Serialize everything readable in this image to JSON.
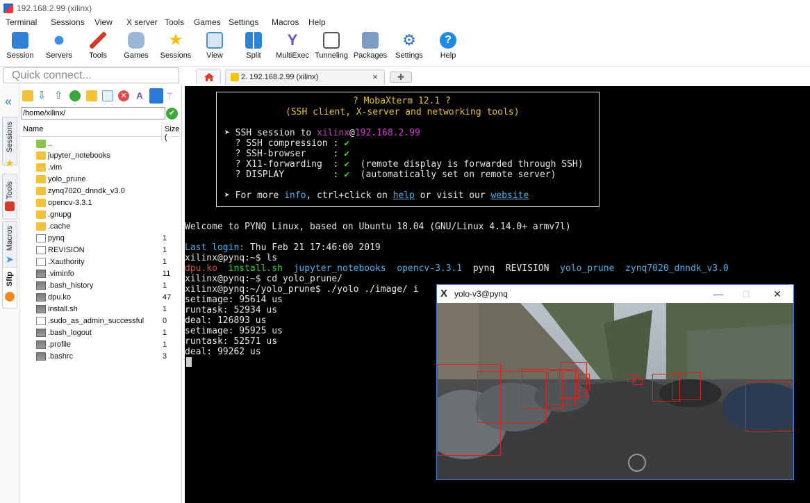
{
  "window": {
    "title": "192.168.2.99 (xilinx)"
  },
  "menu": [
    "Terminal",
    "Sessions",
    "View",
    "X server",
    "Tools",
    "Games",
    "Settings",
    "Macros",
    "Help"
  ],
  "toolbar": [
    {
      "label": "Session",
      "icon": "session-icon",
      "color": "#2f7fd6"
    },
    {
      "label": "Servers",
      "icon": "servers-icon",
      "color": "#3a8ee6"
    },
    {
      "label": "Tools",
      "icon": "tools-icon",
      "color": "#d23a2a"
    },
    {
      "label": "Games",
      "icon": "games-icon",
      "color": "#5aa0d8"
    },
    {
      "label": "Sessions",
      "icon": "star-icon",
      "color": "#f2c019"
    },
    {
      "label": "View",
      "icon": "view-icon",
      "color": "#4a8fcf"
    },
    {
      "label": "Split",
      "icon": "split-icon",
      "color": "#2c84d4"
    },
    {
      "label": "MultiExec",
      "icon": "multiexec-icon",
      "color": "#6a55c6"
    },
    {
      "label": "Tunneling",
      "icon": "tunneling-icon",
      "color": "#3aa83a"
    },
    {
      "label": "Packages",
      "icon": "packages-icon",
      "color": "#5a7fb0"
    },
    {
      "label": "Settings",
      "icon": "settings-icon",
      "color": "#2f6fc9"
    },
    {
      "label": "Help",
      "icon": "help-icon",
      "color": "#1e88e5"
    }
  ],
  "quick_connect": {
    "placeholder": "Quick connect..."
  },
  "tabs": [
    {
      "label": "2. 192.168.2.99 (xilinx)",
      "close": "×"
    }
  ],
  "side_tabs": [
    "Sessions",
    "Tools",
    "Macros",
    "Sftp"
  ],
  "sftp": {
    "path": "/home/xilinx/",
    "columns": {
      "name": "Name",
      "size": "Size ("
    },
    "files": [
      {
        "name": "..",
        "size": "",
        "type": "up"
      },
      {
        "name": "jupyter_notebooks",
        "size": "",
        "type": "folder"
      },
      {
        "name": ".vim",
        "size": "",
        "type": "folder"
      },
      {
        "name": "yolo_prune",
        "size": "",
        "type": "folder"
      },
      {
        "name": "zynq7020_dnndk_v3.0",
        "size": "",
        "type": "folder"
      },
      {
        "name": "opencv-3.3.1",
        "size": "",
        "type": "folder"
      },
      {
        "name": ".gnupg",
        "size": "",
        "type": "folder"
      },
      {
        "name": ".cache",
        "size": "",
        "type": "folder"
      },
      {
        "name": "pynq",
        "size": "1",
        "type": "file"
      },
      {
        "name": "REVISION",
        "size": "1",
        "type": "file"
      },
      {
        "name": ".Xauthority",
        "size": "1",
        "type": "file"
      },
      {
        "name": ".viminfo",
        "size": "11",
        "type": "gfile"
      },
      {
        "name": ".bash_history",
        "size": "1",
        "type": "gfile"
      },
      {
        "name": "dpu.ko",
        "size": "47",
        "type": "gfile"
      },
      {
        "name": "install.sh",
        "size": "1",
        "type": "gfile"
      },
      {
        "name": ".sudo_as_admin_successful",
        "size": "0",
        "type": "file"
      },
      {
        "name": ".bash_logout",
        "size": "1",
        "type": "gfile"
      },
      {
        "name": ".profile",
        "size": "1",
        "type": "gfile"
      },
      {
        "name": ".bashrc",
        "size": "3",
        "type": "gfile"
      }
    ]
  },
  "terminal": {
    "banner": {
      "title": "? MobaXterm 12.1 ?",
      "subtitle": "(SSH client, X-server and networking tools)",
      "session_prefix": "➤ SSH session to ",
      "user": "xilinx",
      "at": "@",
      "host": "192.168.2.99",
      "lines": [
        {
          "label": "  ? SSH compression : ",
          "check": "✔",
          "note": ""
        },
        {
          "label": "  ? SSH-browser     : ",
          "check": "✔",
          "note": ""
        },
        {
          "label": "  ? X11-forwarding  : ",
          "check": "✔",
          "note": "  (remote display is forwarded through SSH)"
        },
        {
          "label": "  ? DISPLAY         : ",
          "check": "✔",
          "note": "  (automatically set on remote server)"
        }
      ],
      "more_prefix": "➤ For more ",
      "more_info": "info",
      "more_mid": ", ctrl+click on ",
      "more_help": "help",
      "more_mid2": " or visit our ",
      "more_website": "website"
    },
    "welcome": "Welcome to PYNQ Linux, based on Ubuntu 18.04 (GNU/Linux 4.14.0+ armv7l)",
    "last_login_label": "Last login:",
    "last_login_value": " Thu Feb 21 17:46:00 2019",
    "prompt1": "xilinx@pynq:~$ ls",
    "ls": [
      {
        "name": "dpu.ko",
        "color": "#e04a2f"
      },
      {
        "name": "install.sh",
        "color": "#3bd13b"
      },
      {
        "name": "jupyter_notebooks",
        "color": "#4fb0e8"
      },
      {
        "name": "opencv-3.3.1",
        "color": "#4fb0e8"
      },
      {
        "name": "pynq",
        "color": "#e6e6e6"
      },
      {
        "name": "REVISION",
        "color": "#e6e6e6"
      },
      {
        "name": "yolo_prune",
        "color": "#4fb0e8"
      },
      {
        "name": "zynq7020_dnndk_v3.0",
        "color": "#4fb0e8"
      }
    ],
    "prompt2": "xilinx@pynq:~$ cd yolo_prune/",
    "prompt3": "xilinx@pynq:~/yolo_prune$ ./yolo ./image/ i",
    "output": [
      "setimage: 95614 us",
      "runtask: 52934 us",
      "deal: 126893 us",
      "setimage: 95925 us",
      "runtask: 52571 us",
      "deal: 99262 us"
    ]
  },
  "x11_window": {
    "title": "yolo-v3@pynq",
    "minimize": "—",
    "maximize": "□",
    "close": "✕",
    "detections": 12
  }
}
